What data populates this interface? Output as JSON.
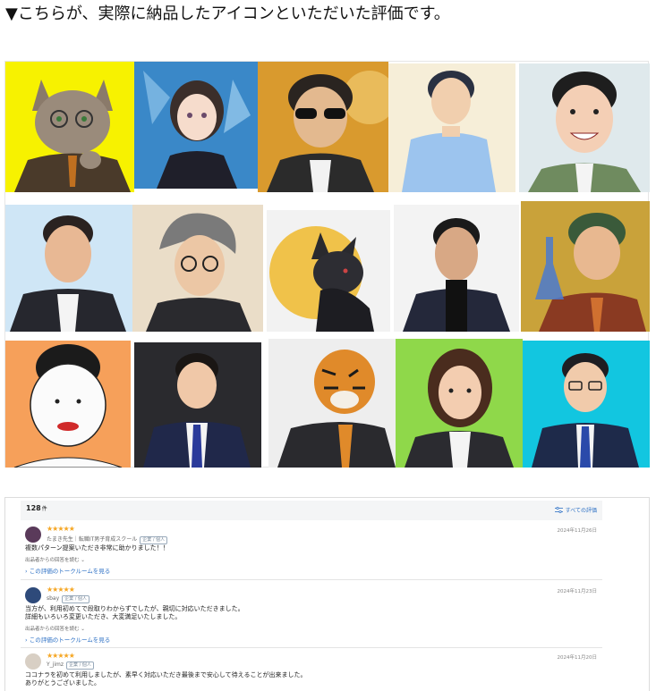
{
  "heading": "▼こちらが、実際に納品したアイコンといただいた評価です。",
  "gallery": {
    "images": [
      {
        "name": "cat-glasses-illustration",
        "bg": "#f7f200"
      },
      {
        "name": "anime-woman-illustration",
        "bg": "#3a88c8"
      },
      {
        "name": "sunglasses-man-illustration",
        "bg": "#d99a2e"
      },
      {
        "name": "nurse-man-illustration",
        "bg": "#f6eed8"
      },
      {
        "name": "smiling-man-illustration",
        "bg": "#dfe9ec"
      },
      {
        "name": "suit-man-blue-bg-illustration",
        "bg": "#cfe6f6"
      },
      {
        "name": "gray-hair-glasses-man-illustration",
        "bg": "#eaddc8"
      },
      {
        "name": "black-cat-illustration",
        "bg": "#f0c24a"
      },
      {
        "name": "turtleneck-man-illustration",
        "bg": "#f3f3f3"
      },
      {
        "name": "flask-man-illustration",
        "bg": "#c9a23a"
      },
      {
        "name": "woman-red-lips-illustration",
        "bg": "#f6a05a"
      },
      {
        "name": "young-man-tie-illustration",
        "bg": "#2a2a2e"
      },
      {
        "name": "tiger-suit-illustration",
        "bg": "#eeeeee"
      },
      {
        "name": "businesswoman-illustration",
        "bg": "#8fd84a"
      },
      {
        "name": "glasses-man-cyan-illustration",
        "bg": "#12c6e0"
      }
    ]
  },
  "reviews": {
    "count": "128",
    "count_unit": "件",
    "all_link": "すべての評価",
    "items": [
      {
        "stars": "★★★★★",
        "user": "たまき先生｜転職IT男子育成スクール",
        "badge": "企業 / 個人",
        "date": "2024年11月26日",
        "lines": [
          "複数パターン提案いただき非常に助かりました！！"
        ],
        "seller_reply": "出品者からの回答を読む",
        "talk_link": "この評価のトークルームを見る"
      },
      {
        "stars": "★★★★★",
        "user": "sbay",
        "badge": "企業 / 個人",
        "date": "2024年11月23日",
        "lines": [
          "当方が、利用初めてで段取りわからずでしたが、親切に対応いただきました。",
          "詳細もいろいろ変更いただき、大変満足いたしました。"
        ],
        "seller_reply": "出品者からの回答を読む",
        "talk_link": "この評価のトークルームを見る"
      },
      {
        "stars": "★★★★★",
        "user": "Y_jimz",
        "badge": "企業 / 個人",
        "date": "2024年11月20日",
        "lines": [
          "ココナラを初めて利用しましたが、素早く対応いただき最後まで安心して待えることが出来ました。",
          "ありがとうございました。"
        ]
      }
    ]
  }
}
